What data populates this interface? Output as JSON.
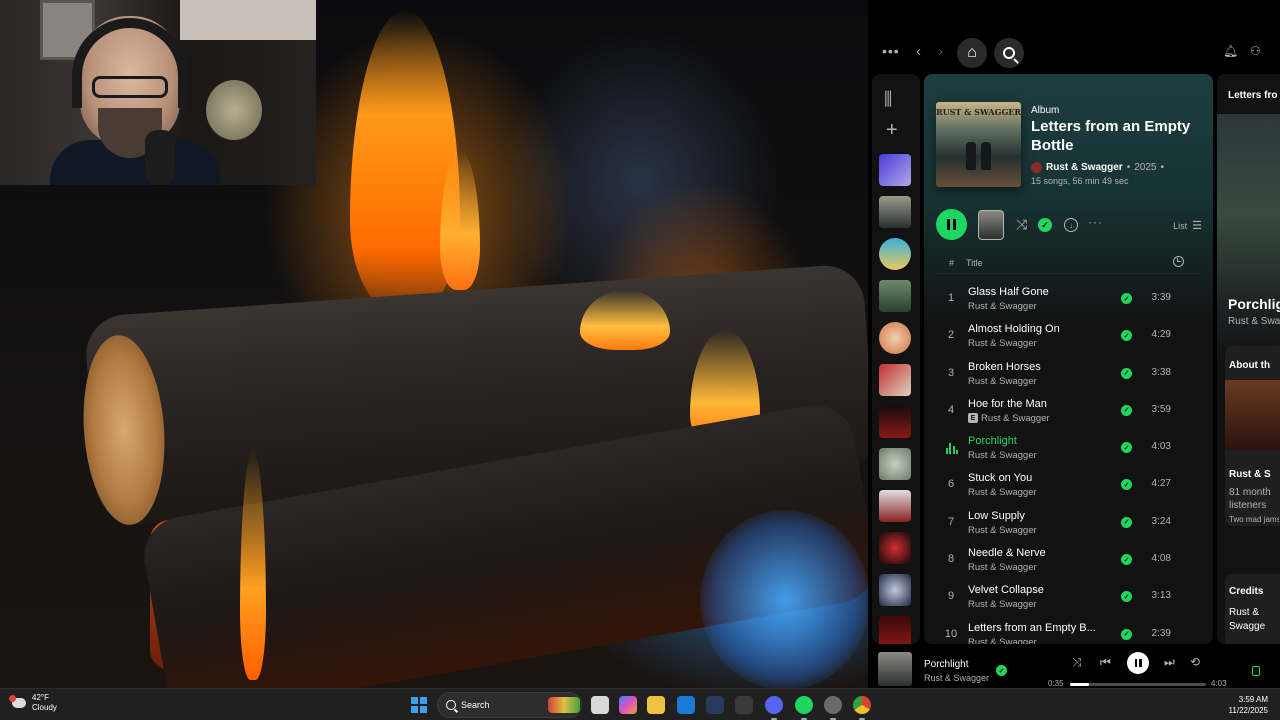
{
  "album": {
    "type_label": "Album",
    "title": "Letters from an Empty Bottle",
    "artist": "Rust & Swagger",
    "year": "2025",
    "meta": "15 songs, 56 min 49 sec",
    "cover_text": "RUST & SWAGGER"
  },
  "actions": {
    "list_label": "List"
  },
  "table_header": {
    "number": "#",
    "title": "Title"
  },
  "tracks": [
    {
      "num": "1",
      "title": "Glass Half Gone",
      "artist": "Rust & Swagger",
      "duration": "3:39",
      "explicit": false,
      "playing": false
    },
    {
      "num": "2",
      "title": "Almost Holding On",
      "artist": "Rust & Swagger",
      "duration": "4:29",
      "explicit": false,
      "playing": false
    },
    {
      "num": "3",
      "title": "Broken Horses",
      "artist": "Rust & Swagger",
      "duration": "3:38",
      "explicit": false,
      "playing": false
    },
    {
      "num": "4",
      "title": "Hoe for the Man",
      "artist": "Rust & Swagger",
      "duration": "3:59",
      "explicit": true,
      "playing": false
    },
    {
      "num": "5",
      "title": "Porchlight",
      "artist": "Rust & Swagger",
      "duration": "4:03",
      "explicit": false,
      "playing": true
    },
    {
      "num": "6",
      "title": "Stuck on You",
      "artist": "Rust & Swagger",
      "duration": "4:27",
      "explicit": false,
      "playing": false
    },
    {
      "num": "7",
      "title": "Low Supply",
      "artist": "Rust & Swagger",
      "duration": "3:24",
      "explicit": false,
      "playing": false
    },
    {
      "num": "8",
      "title": "Needle & Nerve",
      "artist": "Rust & Swagger",
      "duration": "4:08",
      "explicit": false,
      "playing": false
    },
    {
      "num": "9",
      "title": "Velvet Collapse",
      "artist": "Rust & Swagger",
      "duration": "3:13",
      "explicit": false,
      "playing": false
    },
    {
      "num": "10",
      "title": "Letters from an Empty B...",
      "artist": "Rust & Swagger",
      "duration": "2:39",
      "explicit": false,
      "playing": false
    }
  ],
  "right_panel": {
    "header": "Letters fro",
    "song_title": "Porchlig",
    "song_artist": "Rust & Swa",
    "about_title": "About th",
    "about_name": "Rust & S",
    "about_listeners": "81 month listeners",
    "about_bio": "Two mad jams... we",
    "credits_title": "Credits",
    "credits_artist": "Rust & Swagge"
  },
  "now_playing": {
    "title": "Porchlight",
    "artist": "Rust & Swagger",
    "elapsed": "0:35",
    "total": "4:03",
    "progress": 0.14
  },
  "taskbar": {
    "weather_temp": "42°F",
    "weather_desc": "Cloudy",
    "search_label": "Search",
    "time": "3:59 AM",
    "date": "11/22/2025"
  },
  "colors": {
    "accent": "#1ed760",
    "album_bg": "#1e3e40",
    "panel_bg": "#121212"
  },
  "icons": {
    "library": "library-icon",
    "add": "plus-icon",
    "home": "home-icon",
    "search": "search-icon"
  }
}
